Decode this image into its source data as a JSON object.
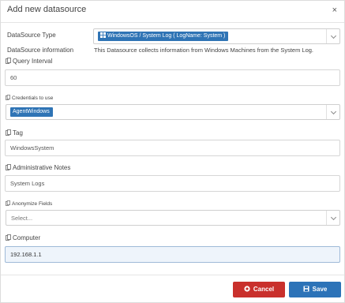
{
  "dialog": {
    "title": "Add new datasource",
    "close_glyph": "×"
  },
  "form": {
    "datasource_type": {
      "label": "DataSource Type",
      "selected": "WindowsOS / System Log ( LogName: System )"
    },
    "datasource_info": {
      "label": "DataSource information",
      "text": "This Datasource collects information from Windows Machines from the System Log."
    },
    "query_interval": {
      "label": "Query Interval",
      "value": "60"
    },
    "credentials": {
      "label": "Credentials to use",
      "selected": "AgentWindows"
    },
    "tag": {
      "label": "Tag",
      "value": "WindowsSystem"
    },
    "admin_notes": {
      "label": "Administrative Notes",
      "value": "System Logs"
    },
    "anonymize": {
      "label": "Anonymize Fields",
      "placeholder": "Select..."
    },
    "computer": {
      "label": "Computer",
      "value": "192.168.1.1"
    }
  },
  "footer": {
    "cancel_label": "Cancel",
    "save_label": "Save"
  },
  "colors": {
    "chip": "#2f74b5",
    "cancel": "#c9302c",
    "save": "#2c73b8",
    "active_input_bg": "#eef4fb"
  },
  "icons": [
    "copy-icon",
    "windows-icon",
    "chevron-down-icon",
    "close-icon",
    "cancel-circle-icon",
    "save-disk-icon"
  ]
}
